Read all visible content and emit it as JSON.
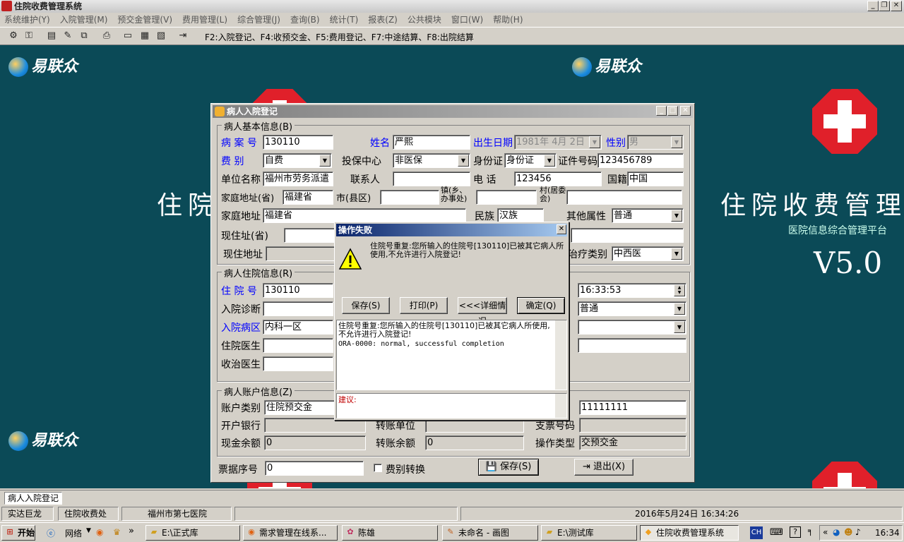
{
  "app": {
    "title": "住院收费管理系统",
    "menu": [
      "系统维护(Y)",
      "入院管理(M)",
      "预交金管理(V)",
      "费用管理(L)",
      "综合管理(J)",
      "查询(B)",
      "统计(T)",
      "报表(Z)",
      "公共模块",
      "窗口(W)",
      "帮助(H)"
    ],
    "toolbar_hint": "F2:入院登记、F4:收预交金、F5:费用登记、F7:中途结算、F8:出院结算"
  },
  "desktop": {
    "logo_text": "易联众",
    "big_title": "住院收费管理理",
    "subtitle": "医院信息综合管理平台",
    "version": "V5.0",
    "big_title_left": "住院"
  },
  "form": {
    "title": "病人入院登记",
    "basic": {
      "group_label": "病人基本信息(B)",
      "case_no_label": "病 案 号",
      "case_no": "130110",
      "name_label": "姓名",
      "name": "严熙",
      "birth_label": "出生日期",
      "birth": "1981年 4月 2日",
      "sex_label": "性别",
      "sex": "男",
      "fee_type_label": "费    别",
      "fee_type": "自费",
      "insure_label": "投保中心",
      "insure": "非医保",
      "id_type_label": "身份证",
      "id_type": "身份证",
      "id_no_label": "证件号码",
      "id_no": "123456789",
      "company_label": "单位名称",
      "company": "福州市劳务派遣",
      "contact_label": "联系人",
      "contact": "",
      "phone_label": "电    话",
      "phone": "123456",
      "nation_label": "国籍",
      "nation": "中国",
      "home_prov_label": "家庭地址(省)",
      "home_prov": "福建省",
      "city_label": "市(县区)",
      "city": "",
      "town_label": "镇(乡、办事处)",
      "town": "",
      "village_label": "村(居委会)",
      "village": "",
      "home_addr_label": "家庭地址",
      "home_addr": "福建省",
      "ethnic_label": "民族",
      "ethnic": "汉族",
      "other_label": "其他属性",
      "other": "普通",
      "cur_prov_label": "现住址(省)",
      "cur_prov": "",
      "cur_addr_label": "现住地址",
      "cur_addr": "",
      "treat_label": "治疗类别",
      "treat": "中西医"
    },
    "hosp": {
      "group_label": "病人住院信息(R)",
      "inpatient_no_label": "住 院 号",
      "inpatient_no": "130110",
      "diag_label": "入院诊断",
      "diag": "",
      "ward_label": "入院病区",
      "ward": "内科一区",
      "doctor_label": "住院医生",
      "doctor": "",
      "treat_doctor_label": "收治医生",
      "treat_doctor": "",
      "time": "16:33:53",
      "level": "普通"
    },
    "account": {
      "group_label": "病人账户信息(Z)",
      "acct_type_label": "账户类别",
      "acct_type": "住院预交金",
      "amount": "11111111",
      "bank_label": "开户银行",
      "bank": "",
      "transfer_unit_label": "转账单位",
      "transfer_unit": "",
      "check_no_label": "支票号码",
      "check_no": "",
      "cash_label": "现金余额",
      "cash": "0",
      "transfer_bal_label": "转账余额",
      "transfer_bal": "0",
      "op_type_label": "操作类型",
      "op_type": "交预交金"
    },
    "ticket_label": "票据序号",
    "ticket": "0",
    "switch_label": "费别转换",
    "save_label": "保存(S)",
    "exit_label": "退出(X)"
  },
  "dialog": {
    "title": "操作失败",
    "message": "住院号重复:您所输入的住院号[130110]已被其它病人所使用,不允许进行入院登记!",
    "buttons": [
      "保存(S)",
      "打印(P)",
      "<<<详细情况",
      "确定(Q)"
    ],
    "detail_line1": "住院号重复:您所输入的住院号[130110]已被其它病人所使用,不允许进行入院登记!",
    "detail_line2": "ORA-0000: normal, successful completion",
    "advice_label": "建议:"
  },
  "statusbar": {
    "window_tab": "病人入院登记",
    "company": "实达巨龙",
    "dept": "住院收费处",
    "hospital": "福州市第七医院",
    "datetime": "2016年5月24日 16:34:26"
  },
  "taskbar": {
    "start": "开始",
    "network": "网络",
    "items": [
      "E:\\正式库",
      "需求管理在线系...",
      "陈雄",
      "未命名 - 画图",
      "E:\\测试库",
      "住院收费管理系统"
    ],
    "lang": "CH",
    "clock": "16:34"
  }
}
